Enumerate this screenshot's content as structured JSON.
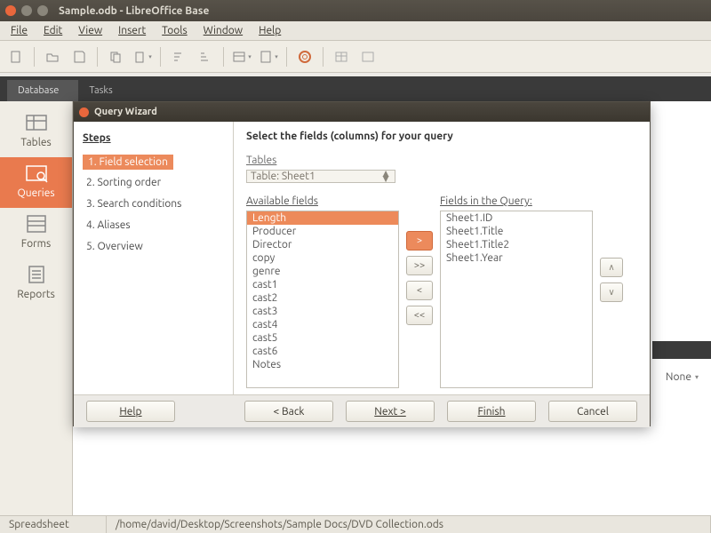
{
  "window": {
    "title": "Sample.odb - LibreOffice Base"
  },
  "menubar": [
    "File",
    "Edit",
    "View",
    "Insert",
    "Tools",
    "Window",
    "Help"
  ],
  "db_tabs": {
    "items": [
      "Database",
      "Tasks"
    ],
    "active": 0
  },
  "db_pane": [
    {
      "label": "Tables"
    },
    {
      "label": "Queries"
    },
    {
      "label": "Forms"
    },
    {
      "label": "Reports"
    }
  ],
  "db_pane_active": 1,
  "behind_select": "None",
  "wizard": {
    "title": "Query Wizard",
    "steps_header": "Steps",
    "steps": [
      "1. Field selection",
      "2. Sorting order",
      "3. Search conditions",
      "4. Aliases",
      "5. Overview"
    ],
    "active_step": 0,
    "heading": "Select the fields (columns) for your query",
    "tables_label": "Tables",
    "tables_value": "Table: Sheet1",
    "available_label": "Available fields",
    "available": [
      "Length",
      "Producer",
      "Director",
      "copy",
      "genre",
      "cast1",
      "cast2",
      "cast3",
      "cast4",
      "cast5",
      "cast6",
      "Notes"
    ],
    "available_selected": 0,
    "in_query_label": "Fields in the Query:",
    "in_query": [
      "Sheet1.ID",
      "Sheet1.Title",
      "Sheet1.Title2",
      "Sheet1.Year"
    ],
    "move": {
      "add": ">",
      "add_all": ">>",
      "remove": "<",
      "remove_all": "<<"
    },
    "reorder": {
      "up": "∧",
      "down": "∨"
    },
    "footer": {
      "help": "Help",
      "back": "< Back",
      "next": "Next >",
      "finish": "Finish",
      "cancel": "Cancel"
    }
  },
  "statusbar": {
    "left": "Spreadsheet",
    "path": "/home/david/Desktop/Screenshots/Sample Docs/DVD Collection.ods"
  }
}
